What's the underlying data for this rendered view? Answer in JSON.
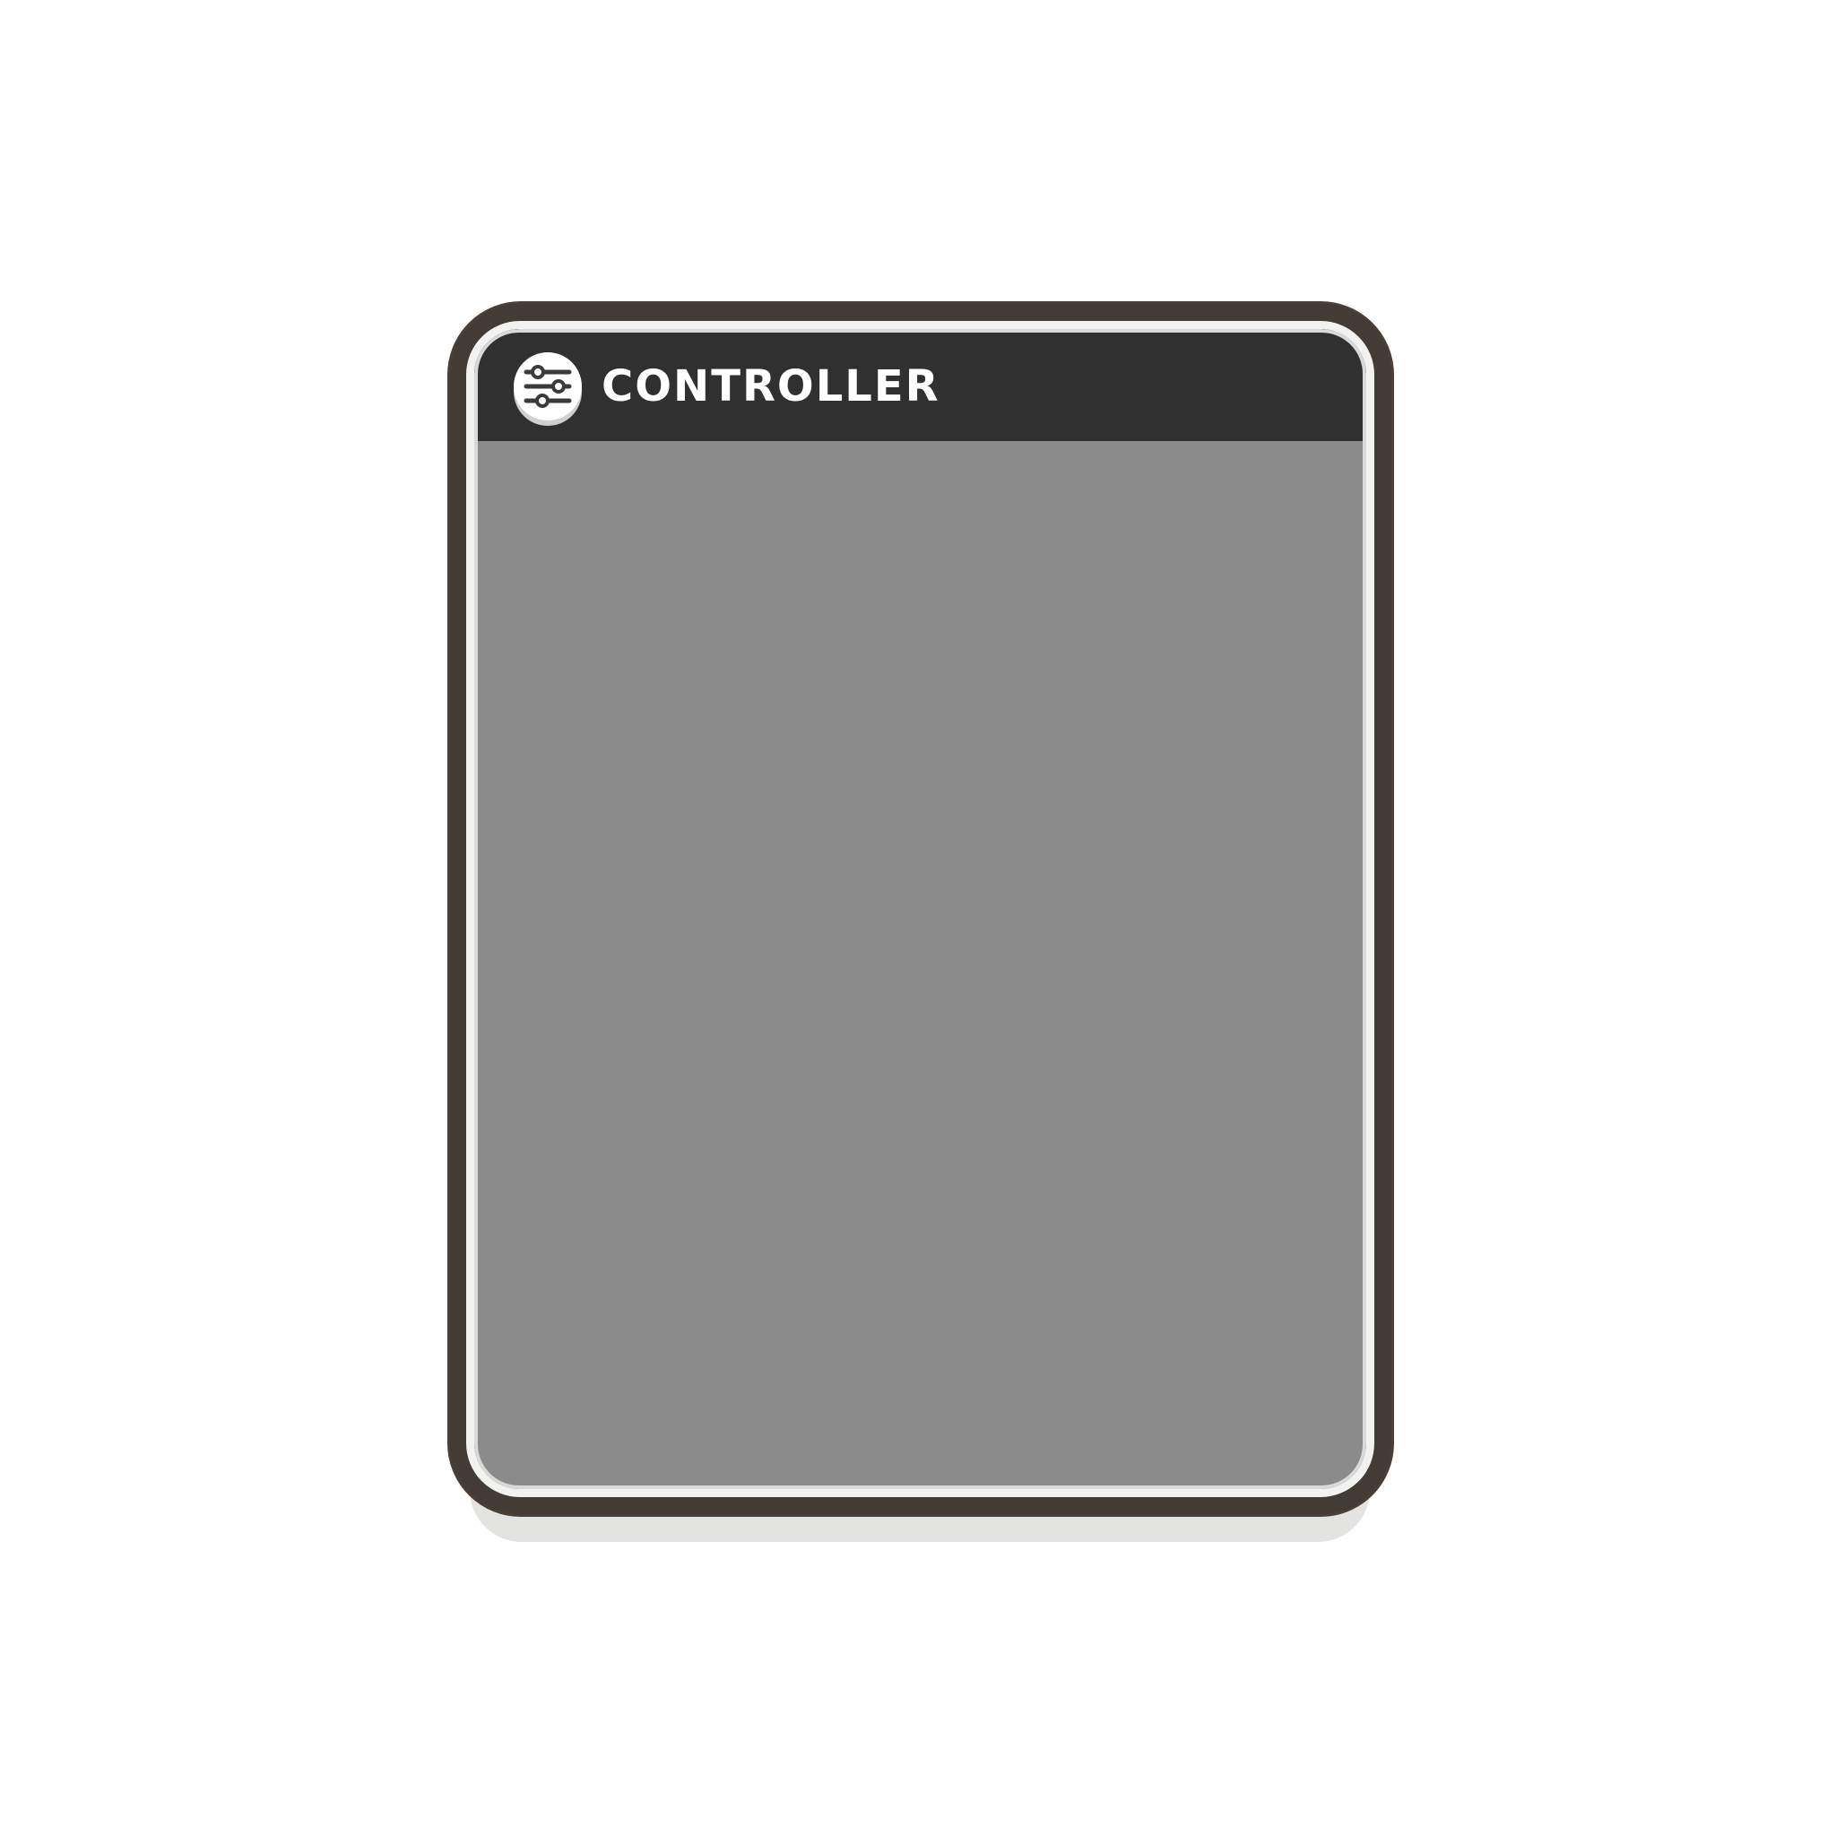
{
  "panel": {
    "title": "CONTROLLER",
    "logo_icon": "sliders-icon"
  },
  "colors": {
    "frame": "#433b35",
    "header": "#303030",
    "content": "#8b8b8b",
    "title_text": "#ffffff"
  }
}
